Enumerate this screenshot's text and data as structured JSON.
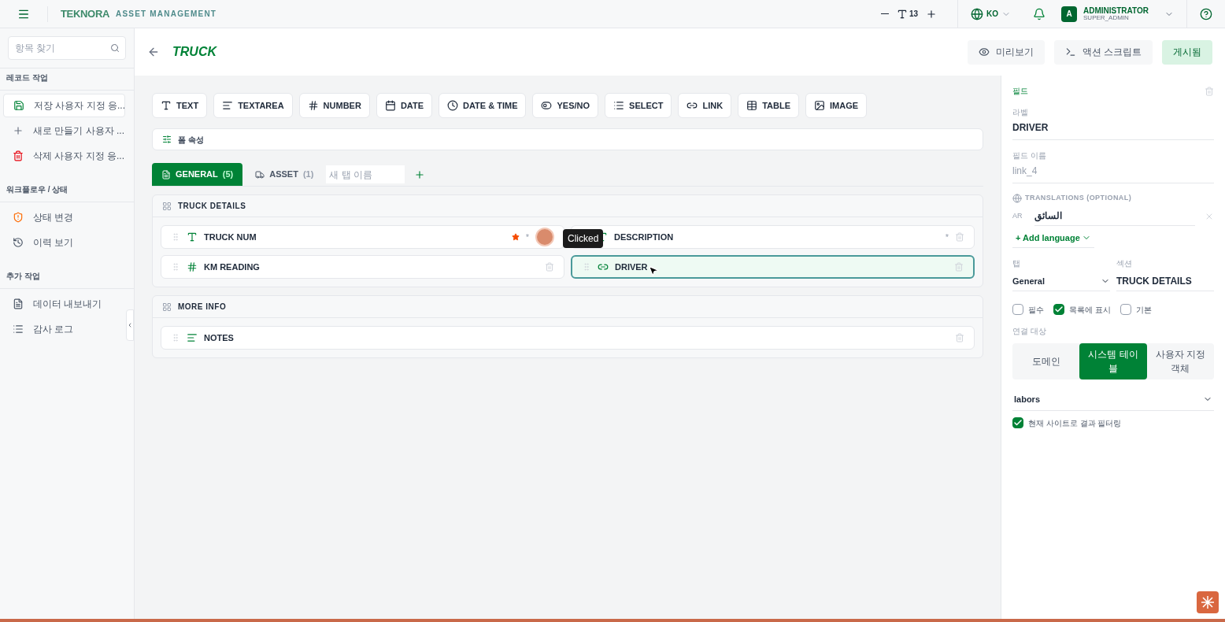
{
  "header": {
    "brand": "TEKNORA",
    "subtitle": "ASSET MANAGEMENT",
    "font_size": "13",
    "language": "KO",
    "user": {
      "initial": "A",
      "name": "ADMINISTRATOR",
      "role": "SUPER_ADMIN"
    }
  },
  "sidebar": {
    "search_placeholder": "항목 찾기",
    "groups": [
      {
        "title": "레코드 작업",
        "items": [
          {
            "label": "저장 사용자 지정 응...",
            "selected": true
          },
          {
            "label": "새로 만들기 사용자 ...",
            "selected": false
          },
          {
            "label": "삭제 사용자 지정 응...",
            "selected": false
          }
        ]
      },
      {
        "title": "워크플로우 / 상태",
        "items": [
          {
            "label": "상태 변경",
            "selected": false
          },
          {
            "label": "이력 보기",
            "selected": false
          }
        ]
      },
      {
        "title": "추가 작업",
        "items": [
          {
            "label": "데이터 내보내기",
            "selected": false
          },
          {
            "label": "감사 로그",
            "selected": false
          }
        ]
      }
    ]
  },
  "page": {
    "title": "TRUCK",
    "actions": [
      {
        "label": "미리보기",
        "kind": "preview"
      },
      {
        "label": "액션 스크립트",
        "kind": "script"
      },
      {
        "label": "게시됨",
        "kind": "published"
      }
    ]
  },
  "palette": [
    {
      "label": "TEXT",
      "kind": "text"
    },
    {
      "label": "TEXTAREA",
      "kind": "textarea"
    },
    {
      "label": "NUMBER",
      "kind": "number"
    },
    {
      "label": "DATE",
      "kind": "date"
    },
    {
      "label": "DATE & TIME",
      "kind": "datetime"
    },
    {
      "label": "YES/NO",
      "kind": "yesno"
    },
    {
      "label": "SELECT",
      "kind": "select"
    },
    {
      "label": "LINK",
      "kind": "link"
    },
    {
      "label": "TABLE",
      "kind": "table"
    },
    {
      "label": "IMAGE",
      "kind": "image"
    }
  ],
  "form_properties": "폼 속성",
  "tabs": [
    {
      "label": "GENERAL",
      "count": "(5)",
      "selected": true
    },
    {
      "label": "ASSET",
      "count": "(1)",
      "selected": false
    }
  ],
  "new_tab_placeholder": "새 탭 이름",
  "sections": [
    {
      "title": "TRUCK DETAILS",
      "fields": [
        {
          "label": "TRUCK NUM",
          "kind": "text",
          "starred": true,
          "marker": "*",
          "selected": false
        },
        {
          "label": "DESCRIPTION",
          "kind": "text",
          "starred": false,
          "marker": "*",
          "selected": false
        },
        {
          "label": "KM READING",
          "kind": "number",
          "starred": false,
          "selected": false
        },
        {
          "label": "DRIVER",
          "kind": "link",
          "starred": false,
          "selected": true
        }
      ]
    },
    {
      "title": "MORE INFO",
      "fields": [
        {
          "label": "NOTES",
          "kind": "textarea",
          "starred": false,
          "selected": false
        }
      ]
    }
  ],
  "tooltip": "Clicked",
  "panel": {
    "title": "필드",
    "label_caption": "라벨",
    "label_value": "DRIVER",
    "name_caption": "필드 이름",
    "name_value": "link_4",
    "translations_title": "TRANSLATIONS (OPTIONAL)",
    "translations": [
      {
        "lang": "AR",
        "value": "السائق"
      }
    ],
    "add_language": "+ Add language",
    "tab_caption": "탭",
    "tab_value": "General",
    "section_caption": "섹션",
    "section_value": "TRUCK DETAILS",
    "checks": [
      {
        "label": "필수",
        "checked": false
      },
      {
        "label": "목록에 표시",
        "checked": true
      },
      {
        "label": "기본",
        "checked": false
      }
    ],
    "target_caption": "연결 대상",
    "targets": [
      {
        "label": "도메인",
        "selected": false
      },
      {
        "label": "시스템 테이블",
        "selected": true
      },
      {
        "label": "사용자 지정 객체",
        "selected": false
      }
    ],
    "table_value": "labors",
    "filter": {
      "label": "현재 사이트로 결과 필터링",
      "checked": true
    }
  }
}
